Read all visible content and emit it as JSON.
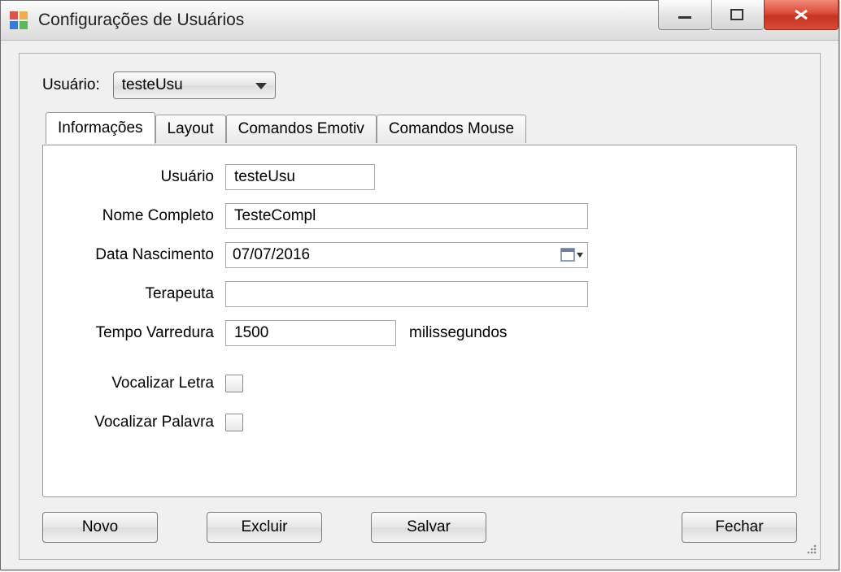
{
  "window": {
    "title": "Configurações de Usuários"
  },
  "topbar": {
    "user_label": "Usuário:",
    "user_value": "testeUsu"
  },
  "tabs": {
    "info": "Informações",
    "layout": "Layout",
    "emotiv": "Comandos Emotiv",
    "mouse": "Comandos Mouse"
  },
  "form": {
    "user_label": "Usuário",
    "user_value": "testeUsu",
    "fullname_label": "Nome Completo",
    "fullname_value": "TesteCompl",
    "birth_label": "Data Nascimento",
    "birth_value": "07/07/2016",
    "therapist_label": "Terapeuta",
    "therapist_value": "",
    "scan_label": "Tempo Varredura",
    "scan_value": "1500",
    "scan_unit": "milissegundos",
    "voc_letter_label": "Vocalizar Letra",
    "voc_word_label": "Vocalizar Palavra"
  },
  "buttons": {
    "new": "Novo",
    "delete": "Excluir",
    "save": "Salvar",
    "close": "Fechar"
  }
}
